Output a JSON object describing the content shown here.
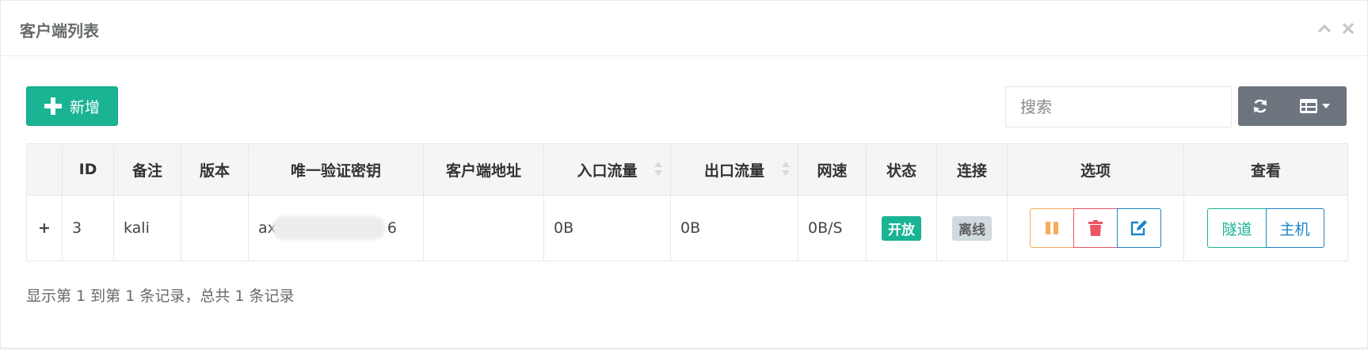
{
  "panel": {
    "title": "客户端列表",
    "tools": {
      "collapse_icon": "chevron-up-icon",
      "close_icon": "close-icon"
    }
  },
  "toolbar": {
    "add_label": "新增",
    "search_placeholder": "搜索",
    "refresh_icon": "refresh-icon",
    "columns_icon": "columns-icon"
  },
  "table": {
    "headers": {
      "expand": "",
      "id": "ID",
      "note": "备注",
      "version": "版本",
      "key": "唯一验证密钥",
      "address": "客户端地址",
      "in_flow": "入口流量",
      "out_flow": "出口流量",
      "speed": "网速",
      "status": "状态",
      "connection": "连接",
      "options": "选项",
      "view": "查看"
    },
    "rows": [
      {
        "expand": "+",
        "id": "3",
        "note": "kali",
        "version": "",
        "key_start": "ax",
        "key_end": "6",
        "address": "",
        "in_flow": "0B",
        "out_flow": "0B",
        "speed": "0B/S",
        "status": "开放",
        "connection": "离线",
        "view_tunnel": "隧道",
        "view_host": "主机"
      }
    ]
  },
  "summary": "显示第 1 到第 1 条记录，总共 1 条记录",
  "colors": {
    "primary": "#1ab394",
    "warning": "#f8ac59",
    "danger": "#ed5565",
    "info": "#1c84c6",
    "gray_button": "#6c757d",
    "expand_plus": "#1f7fe0"
  }
}
